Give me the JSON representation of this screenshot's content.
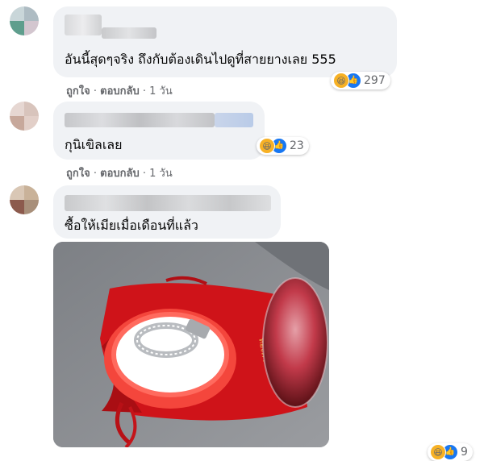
{
  "comments": [
    {
      "text": "อันนี้สุดๆจริง ถึงกับต้องเดินไปดูที่สายยางเลย 555",
      "actions": {
        "like": "ถูกใจ",
        "sep1": " · ",
        "reply": "ตอบกลับ",
        "sep2": " · ",
        "time": "1 วัน"
      },
      "reaction_count": "297",
      "reaction_icons": [
        "haha-icon",
        "like-icon"
      ]
    },
    {
      "text": "กุนิเขิลเลย",
      "actions": {
        "like": "ถูกใจ",
        "sep1": " · ",
        "reply": "ตอบกลับ",
        "sep2": " · ",
        "time": "1 วัน"
      },
      "reaction_count": "23",
      "reaction_icons": [
        "haha-icon",
        "like-icon"
      ]
    },
    {
      "text": "ซื้อให้เมียเมื่อเดือนที่แล้ว",
      "reaction_count": "9",
      "reaction_icons": [
        "haha-icon",
        "like-icon"
      ]
    }
  ],
  "colors": {
    "bubble": "#f0f2f5",
    "meta_text": "#65676b",
    "like_blue": "#1877f2",
    "haha_yellow": "#f7b125",
    "pouch_red": "#d6141b"
  }
}
